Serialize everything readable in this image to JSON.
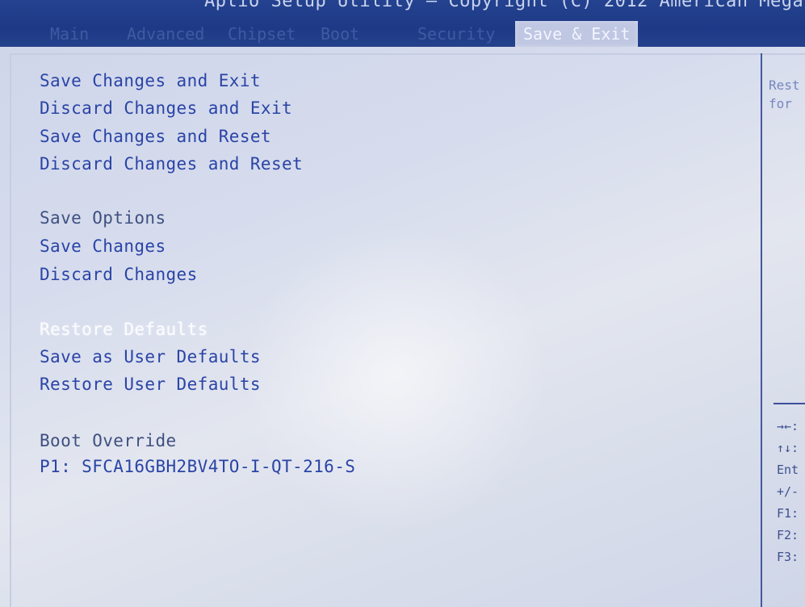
{
  "window": {
    "title": "Aptio Setup Utility – Copyright (C) 2012 American Mega"
  },
  "tabs": [
    {
      "label": "Main",
      "active": false
    },
    {
      "label": "Advanced",
      "active": false
    },
    {
      "label": "Chipset",
      "active": false
    },
    {
      "label": "Boot",
      "active": false
    },
    {
      "label": "Security",
      "active": false
    },
    {
      "label": "Save & Exit",
      "active": true
    }
  ],
  "menu": {
    "items": [
      {
        "label": "Save Changes and Exit",
        "type": "action"
      },
      {
        "label": "Discard Changes and Exit",
        "type": "action"
      },
      {
        "label": "Save Changes and Reset",
        "type": "action"
      },
      {
        "label": "Discard Changes and Reset",
        "type": "action"
      },
      {
        "label": "Save Options",
        "type": "section"
      },
      {
        "label": "Save Changes",
        "type": "action"
      },
      {
        "label": "Discard Changes",
        "type": "action"
      },
      {
        "label": "Restore Defaults",
        "type": "action",
        "selected": true
      },
      {
        "label": "Save as User Defaults",
        "type": "action"
      },
      {
        "label": "Restore User Defaults",
        "type": "action"
      },
      {
        "label": "Boot Override",
        "type": "section"
      },
      {
        "label": "P1: SFCA16GBH2BV4TO-I-QT-216-S",
        "type": "action"
      }
    ]
  },
  "help_panel": {
    "line1": "Rest",
    "line2": "for"
  },
  "key_legend": [
    {
      "key": "→←:",
      "icon": "left-right-arrow-icon"
    },
    {
      "key": "↑↓:",
      "icon": "up-down-arrow-icon"
    },
    {
      "key": "Ent"
    },
    {
      "key": "+/-"
    },
    {
      "key": "F1:"
    },
    {
      "key": "F2:"
    },
    {
      "key": "F3:"
    }
  ],
  "colors": {
    "header_bg": "#1e3a87",
    "panel_bg": "#d6dced",
    "item_text": "#2a44a6",
    "selected_text": "#fbfcff"
  }
}
